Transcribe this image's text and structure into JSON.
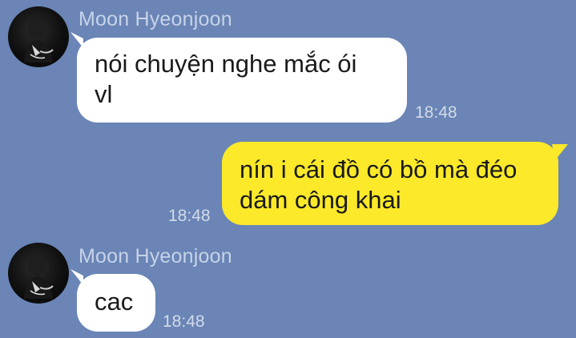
{
  "messages": [
    {
      "sender": "Moon Hyeonjoon",
      "text": "nói chuyện nghe mắc ói\nvl",
      "time": "18:48",
      "direction": "incoming"
    },
    {
      "sender": "",
      "text": "nín i cái đồ có bồ mà đéo\ndám công khai",
      "time": "18:48",
      "direction": "outgoing"
    },
    {
      "sender": "Moon Hyeonjoon",
      "text": "cac",
      "time": "18:48",
      "direction": "incoming"
    }
  ],
  "colors": {
    "background": "#6a85b6",
    "incoming_bubble": "#ffffff",
    "outgoing_bubble": "#fbe92a"
  }
}
